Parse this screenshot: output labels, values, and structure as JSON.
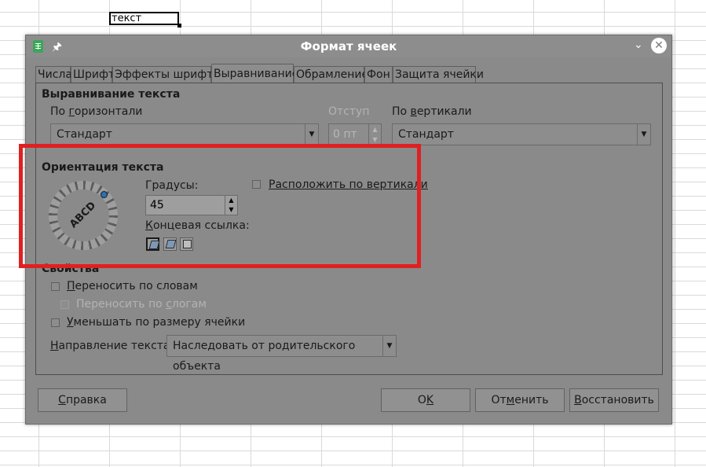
{
  "sheet": {
    "cell_text": "текст"
  },
  "dialog": {
    "title": "Формат ячеек",
    "icons": {
      "app": "spreadsheet-icon",
      "pin": "pin-icon",
      "collapse": "chevron-down-icon",
      "close": "close-icon"
    }
  },
  "tabs": [
    {
      "label": "Числа"
    },
    {
      "label": "Шрифт"
    },
    {
      "label": "Эффекты шрифта"
    },
    {
      "label": "Выравнивание",
      "active": true
    },
    {
      "label": "Обрамление"
    },
    {
      "label": "Фон"
    },
    {
      "label": "Защита ячейки"
    }
  ],
  "alignment": {
    "section_title": "Выравнивание текста",
    "horizontal_label_pre": "По ",
    "horizontal_label_u": "г",
    "horizontal_label_post": "оризонтали",
    "horizontal_value": "Стандарт",
    "indent_label": "Отступ",
    "indent_value": "0 пт",
    "vertical_label_pre": "По ",
    "vertical_label_u": "в",
    "vertical_label_post": "ертикали",
    "vertical_value": "Стандарт"
  },
  "orientation": {
    "section_title": "Ориентация текста",
    "dial_text": "ABCD",
    "degrees_label_pre": "Гра",
    "degrees_label_u": "д",
    "degrees_label_post": "усы:",
    "degrees_value": "45",
    "vertical_stack_label": "Расположить по вертикали",
    "reference_edge_label_u": "К",
    "reference_edge_label_post": "онцевая ссылка:"
  },
  "properties": {
    "section_title": "Свойства",
    "wrap_words_u": "П",
    "wrap_words_post": "ереносить по словам",
    "hyphenate_pre": "Переносить по ",
    "hyphenate_u": "с",
    "hyphenate_post": "логам",
    "shrink_u": "У",
    "shrink_post": "меньшать по размеру ячейки",
    "direction_label_u": "Н",
    "direction_label_post": "аправление текста:",
    "direction_value": "Наследовать от родительского объекта"
  },
  "buttons": {
    "help_u": "С",
    "help_post": "правка",
    "ok_pre": "O",
    "ok_u": "K",
    "cancel_pre": "От",
    "cancel_u": "м",
    "cancel_post": "енить",
    "reset_u": "В",
    "reset_post": "осстановить"
  },
  "colors": {
    "highlight": "#e02020",
    "dialog_bg": "#8a8a8a"
  }
}
